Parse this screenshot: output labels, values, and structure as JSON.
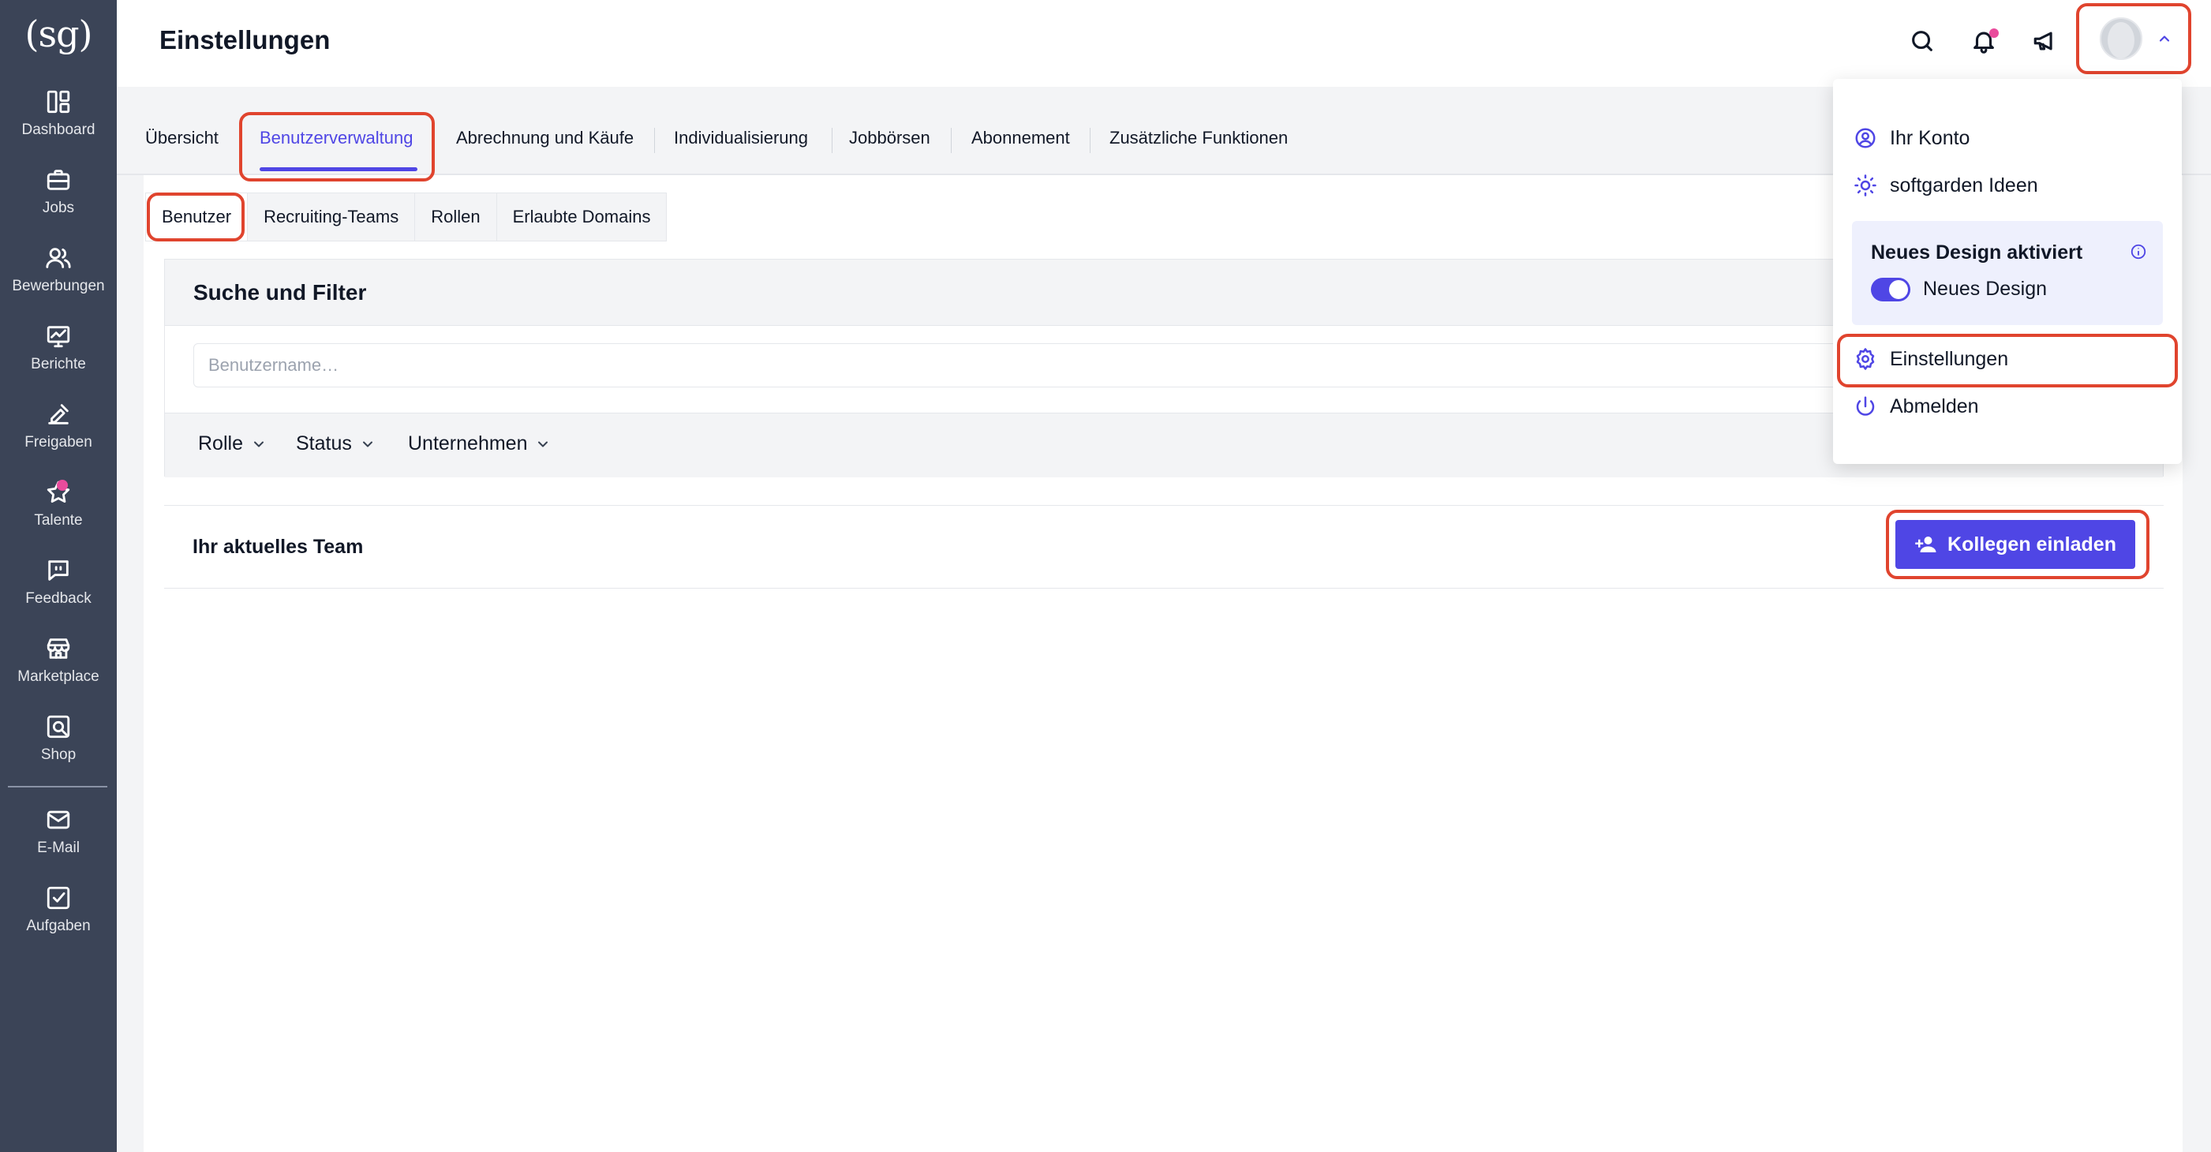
{
  "app": {
    "logo": "(sg)"
  },
  "sidebar": {
    "items": [
      {
        "label": "Dashboard",
        "icon": "dashboard-icon"
      },
      {
        "label": "Jobs",
        "icon": "briefcase-icon"
      },
      {
        "label": "Bewerbungen",
        "icon": "users-icon"
      },
      {
        "label": "Berichte",
        "icon": "chart-icon"
      },
      {
        "label": "Freigaben",
        "icon": "approval-icon"
      },
      {
        "label": "Talente",
        "icon": "star-icon"
      },
      {
        "label": "Feedback",
        "icon": "feedback-icon"
      },
      {
        "label": "Marketplace",
        "icon": "store-icon"
      },
      {
        "label": "Shop",
        "icon": "shop-icon"
      },
      {
        "label": "E-Mail",
        "icon": "mail-icon"
      },
      {
        "label": "Aufgaben",
        "icon": "tasks-icon"
      }
    ]
  },
  "header": {
    "title": "Einstellungen"
  },
  "main_tabs": [
    {
      "label": "Übersicht"
    },
    {
      "label": "Benutzerverwaltung",
      "active": true
    },
    {
      "label": "Abrechnung und Käufe"
    },
    {
      "label": "Individualisierung"
    },
    {
      "label": "Jobbörsen"
    },
    {
      "label": "Abonnement"
    },
    {
      "label": "Zusätzliche Funktionen"
    }
  ],
  "sub_tabs": [
    {
      "label": "Benutzer",
      "active": true
    },
    {
      "label": "Recruiting-Teams"
    },
    {
      "label": "Rollen"
    },
    {
      "label": "Erlaubte Domains"
    }
  ],
  "filter": {
    "title": "Suche und Filter",
    "search_placeholder": "Benutzername…",
    "dropdowns": [
      "Rolle",
      "Status",
      "Unternehmen"
    ]
  },
  "team": {
    "title": "Ihr aktuelles Team",
    "invite_label": "Kollegen einladen"
  },
  "user_menu": {
    "account": "Ihr Konto",
    "ideas": "softgarden Ideen",
    "design_title": "Neues Design aktiviert",
    "design_toggle_label": "Neues Design",
    "settings": "Einstellungen",
    "logout": "Abmelden"
  },
  "colors": {
    "accent": "#4f46e5",
    "sidebar": "#3b4457",
    "highlight": "#e0442e",
    "badge": "#e94b9c"
  }
}
